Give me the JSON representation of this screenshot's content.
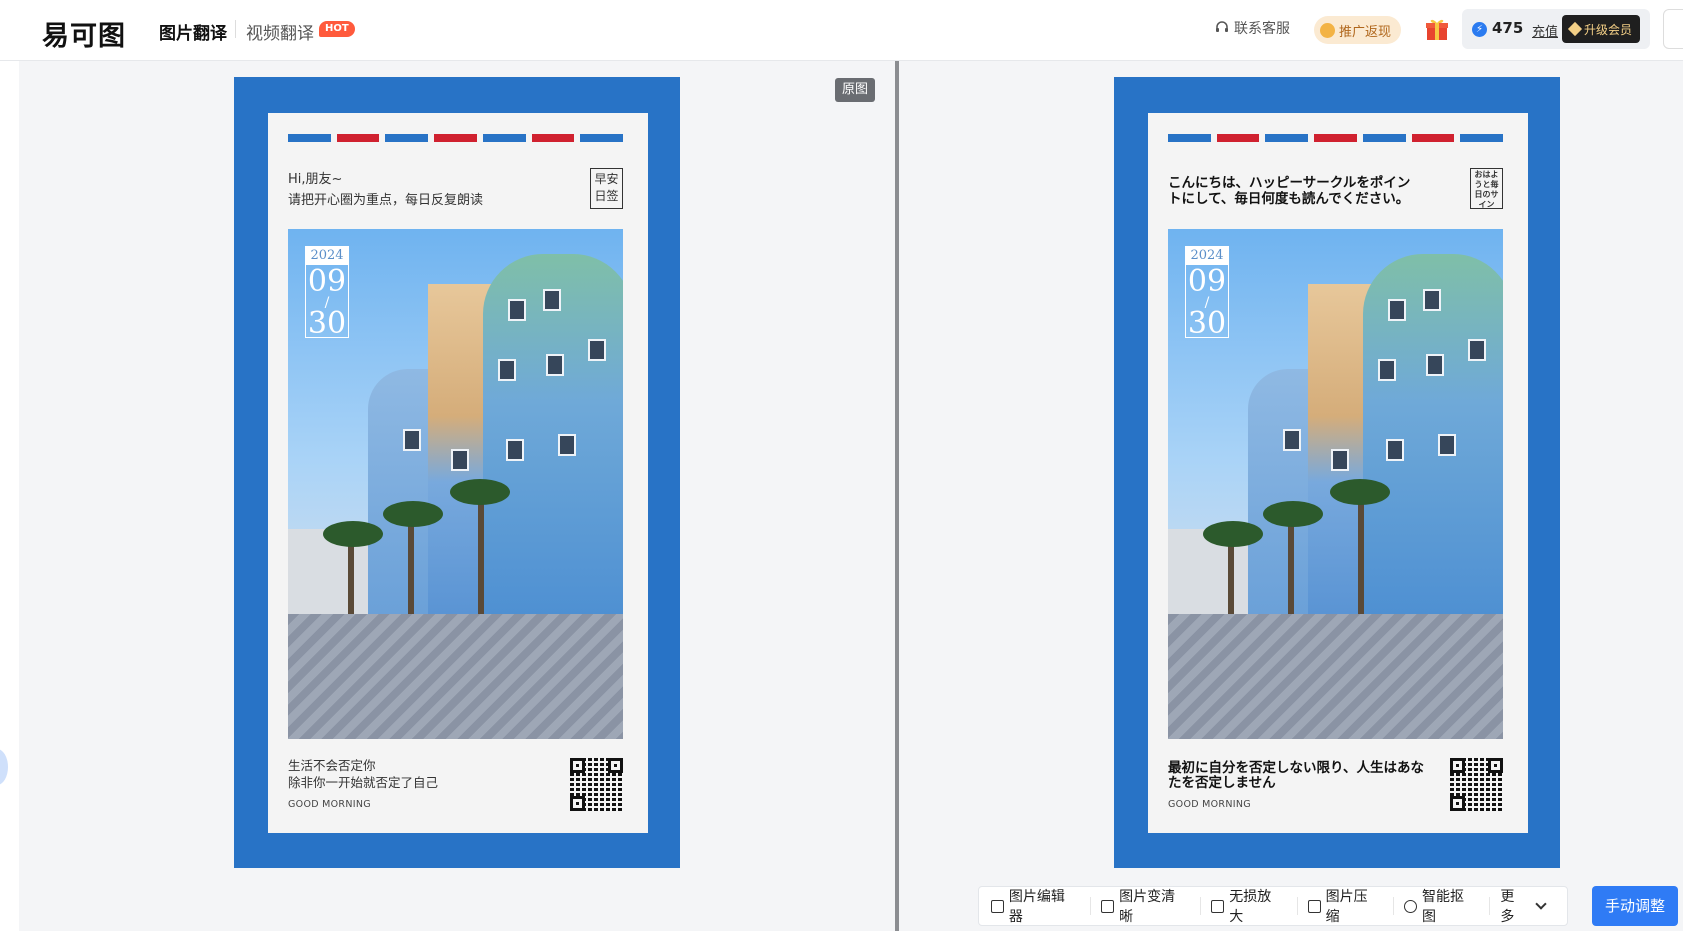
{
  "header": {
    "logo": "易可图",
    "nav_active": "图片翻译",
    "nav_video": "视频翻译",
    "hot_badge": "HOT",
    "support": "联系客服",
    "promo": "推广返现",
    "credits": "475",
    "recharge": "充值",
    "upgrade": "升级会员"
  },
  "canvas": {
    "original_tag": "原图"
  },
  "poster_original": {
    "greeting": [
      "Hi,朋友~",
      "请把开心圈为重点，每日反复朗读"
    ],
    "stamp": [
      "早安",
      "日签"
    ],
    "date_year": "2024",
    "date_mm": "09",
    "date_slash": "/",
    "date_dd": "30",
    "footer": [
      "生活不会否定你",
      "除非你一开始就否定了自己"
    ],
    "good_morning": "GOOD MORNING"
  },
  "poster_translated": {
    "greeting": [
      "こんにちは、ハッピーサークルをポイン",
      "トにして、毎日何度も読んでください。"
    ],
    "stamp": [
      "おはよ",
      "うと毎",
      "日のサ",
      "イン"
    ],
    "date_year": "2024",
    "date_mm": "09",
    "date_slash": "/",
    "date_dd": "30",
    "footer": [
      "最初に自分を否定しない限り、人生はあな",
      "たを否定しません"
    ],
    "good_morning": "GOOD MORNING"
  },
  "toolbar": {
    "items": [
      "图片编辑器",
      "图片变清晰",
      "无损放大",
      "图片压缩",
      "智能抠图"
    ],
    "more": "更多",
    "manual": "手动调整"
  },
  "colors": {
    "poster_blue": "#2873c6",
    "stripe_red": "#d0212f",
    "accent": "#2f7bf5",
    "hot": "#ff5a3c"
  }
}
